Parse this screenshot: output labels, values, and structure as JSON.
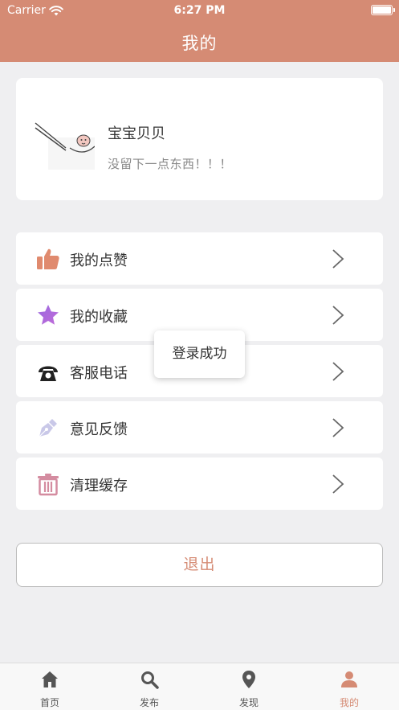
{
  "status_bar": {
    "carrier": "Carrier",
    "time": "6:27 PM"
  },
  "nav": {
    "title": "我的"
  },
  "profile": {
    "nickname": "宝宝贝贝",
    "bio": "没留下一点东西！！！"
  },
  "menu": {
    "items": [
      {
        "label": "我的点赞",
        "icon": "thumbs-up-icon"
      },
      {
        "label": "我的收藏",
        "icon": "star-icon"
      },
      {
        "label": "客服电话",
        "icon": "phone-icon"
      },
      {
        "label": "意见反馈",
        "icon": "pen-icon"
      },
      {
        "label": "清理缓存",
        "icon": "trash-icon"
      }
    ]
  },
  "logout": {
    "label": "退出"
  },
  "toast": {
    "message": "登录成功"
  },
  "tabbar": {
    "tabs": [
      {
        "label": "首页",
        "icon": "home-icon"
      },
      {
        "label": "发布",
        "icon": "search-icon"
      },
      {
        "label": "发现",
        "icon": "location-pin-icon"
      },
      {
        "label": "我的",
        "icon": "person-icon",
        "active": true
      }
    ]
  },
  "colors": {
    "accent": "#d58b74",
    "background": "#efeff1"
  }
}
